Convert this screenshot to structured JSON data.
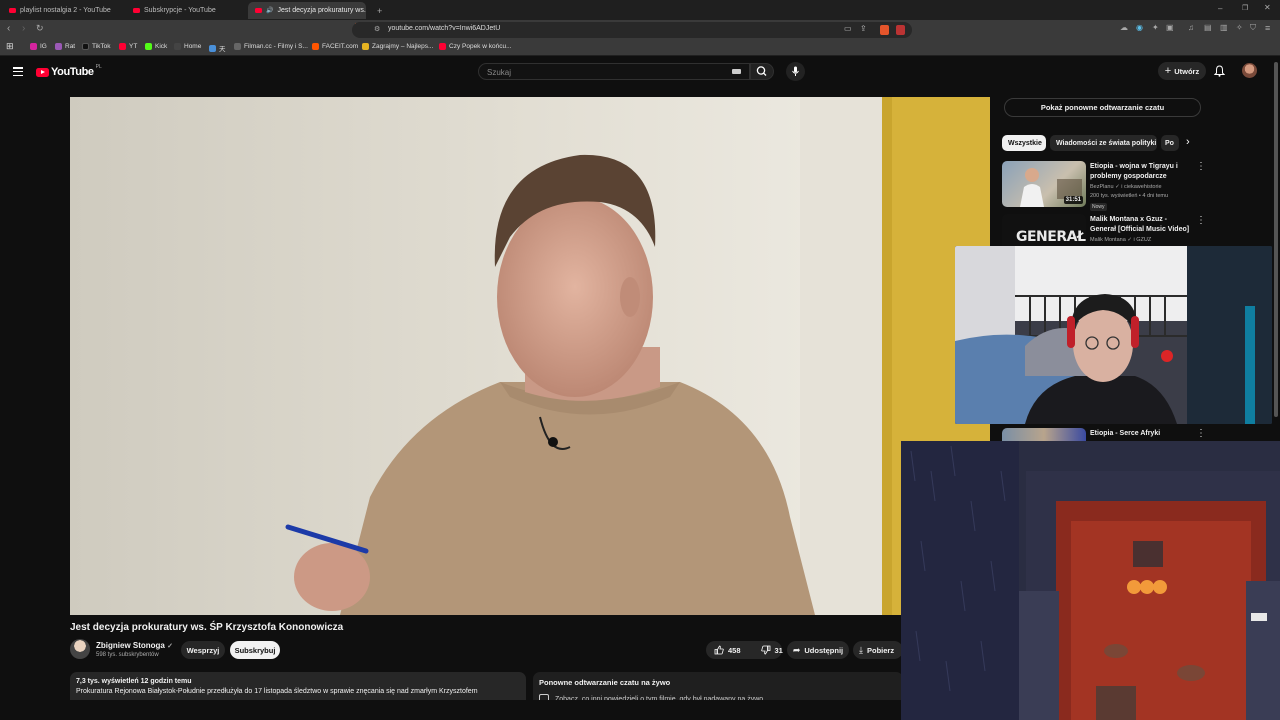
{
  "colors": {
    "youtube_red": "#ff0033",
    "background": "#0f0f0f",
    "chip_active": "#f1f1f1"
  },
  "browser": {
    "tabs": [
      {
        "label": "playlist nostalgia 2 - YouTube",
        "icon": "youtube-icon"
      },
      {
        "label": "Subskrypcje - YouTube",
        "icon": "youtube-icon"
      },
      {
        "label": "Jest decyzja prokuratury ws.",
        "icon": "youtube-icon",
        "active": true
      }
    ],
    "new_tab": "+",
    "url": "youtube.com/watch?v=Inwi6ADJetU",
    "bookmarks": [
      {
        "label": "IG",
        "color": "#d6249f"
      },
      {
        "label": "Rat",
        "color": "#9b59b6"
      },
      {
        "label": "TikTok",
        "color": "#111111"
      },
      {
        "label": "YT",
        "color": "#ff0033"
      },
      {
        "label": "Kick",
        "color": "#53fc18"
      },
      {
        "label": "Home",
        "color": "#444444"
      },
      {
        "label": "天",
        "color": "#4a90d9"
      },
      {
        "label": "Filman.cc - Filmy i S...",
        "color": "#666666"
      },
      {
        "label": "FACEIT.com",
        "color": "#ff5500"
      },
      {
        "label": "Zagrajmy – Najleps...",
        "color": "#e6b422"
      },
      {
        "label": "Czy Popek w końcu...",
        "color": "#ff0033"
      }
    ]
  },
  "header": {
    "logo_text": "YouTube",
    "logo_country": "PL",
    "search_placeholder": "Szukaj",
    "create_label": "Utwórz"
  },
  "video": {
    "title": "Jest decyzja prokuratury ws. ŚP Krzysztofa Kononowicza",
    "channel": "Zbigniew Stonoga",
    "subscribers": "598 tys. subskrybentów",
    "support_label": "Wesprzyj",
    "subscribe_label": "Subskrybuj",
    "likes": "458",
    "dislikes": "31",
    "share_label": "Udostępnij",
    "download_label": "Pobierz",
    "views_line": "7,3 tys. wyświetleń  12 godzin temu",
    "description": "Prokuratura Rejonowa Białystok-Południe przedłużyła do 17 listopada śledztwo w sprawie znęcania się nad zmarłym Krzysztofem"
  },
  "chat_replay": {
    "title": "Ponowne odtwarzanie czatu na żywo",
    "subtitle": "Zobacz, co inni powiedzieli o tym filmie, gdy był nadawany na żywo"
  },
  "sidebar": {
    "replay_button": "Pokaż ponowne odtwarzanie czatu",
    "chips": [
      "Wszystkie",
      "Wiadomości ze świata polityki",
      "Po"
    ],
    "recommendations": [
      {
        "title": "Etiopia - wojna w Tigrayu i problemy gospodarcze",
        "channel": "BezPlanu",
        "channel_extra": "i ciekawehistorie",
        "meta": "200 tys. wyświetleń • 4 dni temu",
        "duration": "31:51",
        "badge": "Nowy"
      },
      {
        "title": "Malik Montana x Gzuz - Generał [Official Music Video]",
        "channel": "Malik Montana",
        "channel_extra": "i GZUZ",
        "thumb_text": "GENERAŁ"
      },
      {
        "title": "Etiopia - Serce Afryki"
      }
    ]
  }
}
